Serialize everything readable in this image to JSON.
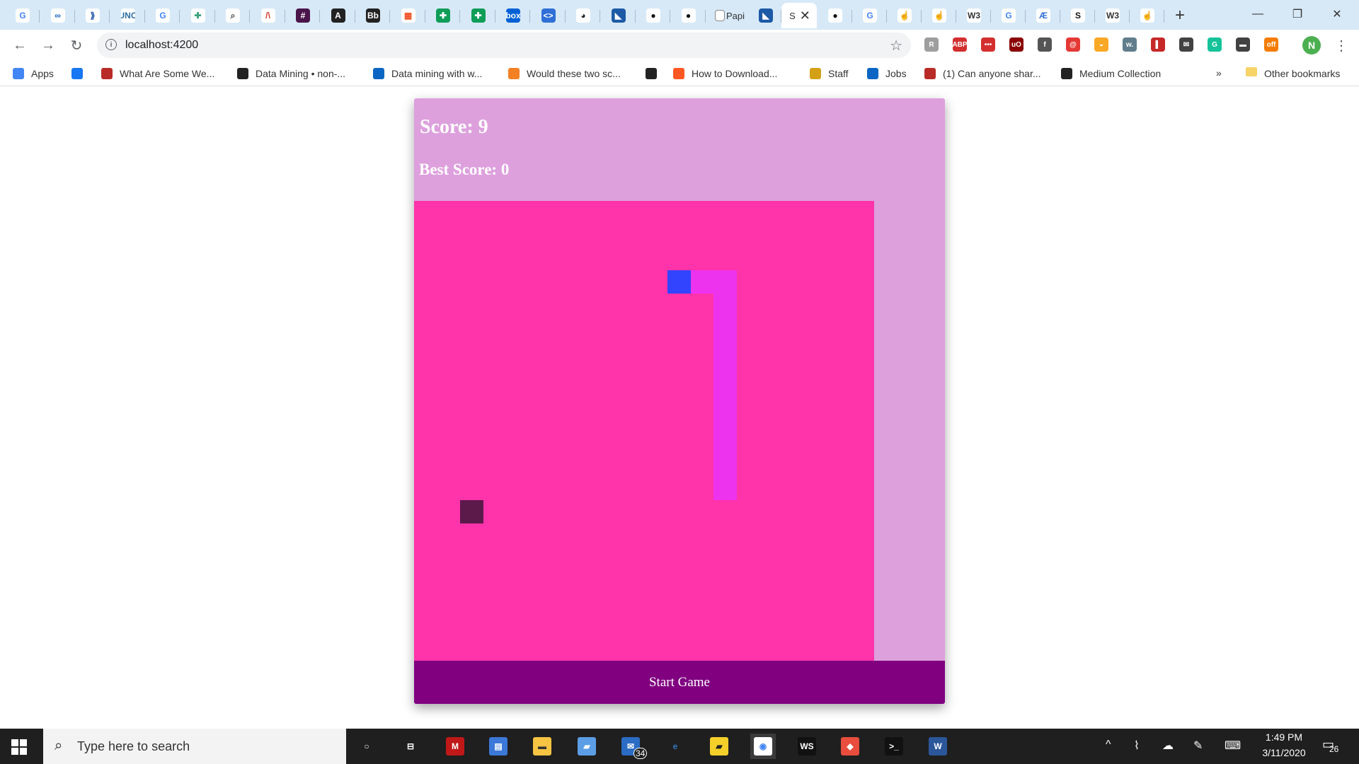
{
  "browser": {
    "tabs_pinned": [
      {
        "icon": "google-icon",
        "glyph": "G",
        "color": "#4285f4",
        "bg": "#ffffff"
      },
      {
        "icon": "coursera-icon",
        "glyph": "∞",
        "color": "#1565c0",
        "bg": "#ffffff"
      },
      {
        "icon": "forward-icon",
        "glyph": "⟫",
        "color": "#1a4ea8",
        "bg": "#ffffff"
      },
      {
        "icon": "uncc-icon",
        "glyph": "UNC",
        "color": "#2e6da4",
        "bg": "#ffffff"
      },
      {
        "icon": "google-icon",
        "glyph": "G",
        "color": "#4285f4",
        "bg": "#ffffff"
      },
      {
        "icon": "puzzle-icon",
        "glyph": "✚",
        "color": "#3aa37c",
        "bg": "#ffffff"
      },
      {
        "icon": "magnifier-icon",
        "glyph": "⌕",
        "color": "#444444",
        "bg": "#ffffff"
      },
      {
        "icon": "lambda-icon",
        "glyph": "/\\",
        "color": "#d23b2f",
        "bg": "#ffffff"
      },
      {
        "icon": "slack-icon",
        "glyph": "#",
        "color": "#ffffff",
        "bg": "#4a154b"
      },
      {
        "icon": "angular-icon",
        "glyph": "A",
        "color": "#ffffff",
        "bg": "#222222"
      },
      {
        "icon": "bb-icon",
        "glyph": "Bb",
        "color": "#ffffff",
        "bg": "#222222"
      },
      {
        "icon": "microsoft-icon",
        "glyph": "▦",
        "color": "#f25022",
        "bg": "#ffffff"
      },
      {
        "icon": "sheets-icon",
        "glyph": "✚",
        "color": "#ffffff",
        "bg": "#0f9d58"
      },
      {
        "icon": "sheets-icon",
        "glyph": "✚",
        "color": "#ffffff",
        "bg": "#0f9d58"
      },
      {
        "icon": "box-icon",
        "glyph": "box",
        "color": "#ffffff",
        "bg": "#0061d5"
      },
      {
        "icon": "code-icon",
        "glyph": "<>",
        "color": "#ffffff",
        "bg": "#2f6fd6"
      },
      {
        "icon": "globe-icon",
        "glyph": "◕",
        "color": "#222222",
        "bg": "#ffffff"
      },
      {
        "icon": "ninja-icon",
        "glyph": "◣",
        "color": "#ffffff",
        "bg": "#1c5aa6"
      },
      {
        "icon": "github-icon",
        "glyph": "●",
        "color": "#111111",
        "bg": "#ffffff"
      },
      {
        "icon": "github-icon",
        "glyph": "●",
        "color": "#111111",
        "bg": "#ffffff"
      }
    ],
    "tab_papi": {
      "icon": "page-icon",
      "title": "Papi"
    },
    "tab_ninja2": {
      "icon": "ninja-icon"
    },
    "tab_active": {
      "title": "S",
      "close": "✕"
    },
    "tabs_after": [
      {
        "icon": "github-icon",
        "glyph": "●",
        "color": "#111111",
        "bg": "#ffffff"
      },
      {
        "icon": "google-icon",
        "glyph": "G",
        "color": "#4285f4",
        "bg": "#ffffff"
      },
      {
        "icon": "hand-icon",
        "glyph": "☝",
        "color": "#e0a060",
        "bg": "#ffffff"
      },
      {
        "icon": "hand-icon",
        "glyph": "☝",
        "color": "#e0a060",
        "bg": "#ffffff"
      },
      {
        "icon": "w3-icon",
        "glyph": "W3",
        "color": "#333333",
        "bg": "#ffffff"
      },
      {
        "icon": "google-icon",
        "glyph": "G",
        "color": "#4285f4",
        "bg": "#ffffff"
      },
      {
        "icon": "azure-icon",
        "glyph": "Æ",
        "color": "#2f6fd6",
        "bg": "#ffffff"
      },
      {
        "icon": "s-icon",
        "glyph": "S",
        "color": "#111111",
        "bg": "#ffffff"
      },
      {
        "icon": "w3-icon",
        "glyph": "W3",
        "color": "#333333",
        "bg": "#ffffff"
      },
      {
        "icon": "hand-icon",
        "glyph": "☝",
        "color": "#e0a060",
        "bg": "#ffffff"
      }
    ],
    "new_tab": "+",
    "window": {
      "minimize": "—",
      "maximize": "❐",
      "close": "✕"
    },
    "nav": {
      "back": "←",
      "forward": "→",
      "reload": "↻"
    },
    "url": "localhost:4200",
    "extensions": [
      {
        "icon": "extension-icon",
        "glyph": "R",
        "bg": "#9e9e9e"
      },
      {
        "icon": "adblock-icon",
        "glyph": "ABP",
        "bg": "#d32f2f"
      },
      {
        "icon": "lastpass-icon",
        "glyph": "•••",
        "bg": "#d32f2f"
      },
      {
        "icon": "ublock-icon",
        "glyph": "uO",
        "bg": "#8b0000"
      },
      {
        "icon": "facebook-icon",
        "glyph": "f",
        "bg": "#555555"
      },
      {
        "icon": "spiral-icon",
        "glyph": "@",
        "bg": "#e53935"
      },
      {
        "icon": "honey-icon",
        "glyph": "◒",
        "bg": "#f9a825"
      },
      {
        "icon": "wordtune-icon",
        "glyph": "w.",
        "bg": "#607d8b"
      },
      {
        "icon": "book-icon",
        "glyph": "▌",
        "bg": "#c62828"
      },
      {
        "icon": "mail-icon",
        "glyph": "✉",
        "bg": "#424242"
      },
      {
        "icon": "grammarly-icon",
        "glyph": "G",
        "bg": "#15c39a"
      },
      {
        "icon": "tag-icon",
        "glyph": "▬",
        "bg": "#424242"
      },
      {
        "icon": "coupon-icon",
        "glyph": "off",
        "bg": "#f57c00"
      }
    ],
    "profile": "N",
    "bookmarks": [
      {
        "icon": "apps-icon",
        "label": "Apps",
        "color": "#4285f4"
      },
      {
        "icon": "facebook-icon",
        "label": "",
        "color": "#1877f2"
      },
      {
        "icon": "quora-icon",
        "label": "What Are Some We...",
        "color": "#b92b27"
      },
      {
        "icon": "globe-icon",
        "label": "Data Mining • non-...",
        "color": "#222222"
      },
      {
        "icon": "linkedin-icon",
        "label": "Data mining with w...",
        "color": "#0a66c2"
      },
      {
        "icon": "stack-icon",
        "label": "Would these two sc...",
        "color": "#f48024"
      },
      {
        "icon": "globe-icon",
        "label": "",
        "color": "#222222"
      },
      {
        "icon": "download-icon",
        "label": "How to Download...",
        "color": "#ff5722"
      },
      {
        "icon": "lambda-icon",
        "label": "Staff",
        "color": "#d4a017"
      },
      {
        "icon": "linkedin-icon",
        "label": "Jobs",
        "color": "#0a66c2"
      },
      {
        "icon": "quora-icon",
        "label": "(1) Can anyone shar...",
        "color": "#b92b27"
      },
      {
        "icon": "medium-icon",
        "label": "Medium Collection",
        "color": "#222222"
      }
    ],
    "bookmarks_more": "»",
    "other_bookmarks": "Other bookmarks"
  },
  "game": {
    "score_text": "Score: 9",
    "best_text": "Best Score: 0",
    "start_label": "Start Game",
    "colors": {
      "panel": "#dda0dd",
      "board": "#ff33aa",
      "snake": "#ee33ee",
      "head": "#3344ff",
      "food": "#5c1a4a",
      "button": "#800080"
    },
    "grid": {
      "cols": 20,
      "rows": 20
    },
    "snake_head": [
      11,
      3
    ],
    "snake_body": [
      [
        12,
        3
      ],
      [
        13,
        3
      ],
      [
        13,
        4
      ],
      [
        13,
        5
      ],
      [
        13,
        6
      ],
      [
        13,
        7
      ],
      [
        13,
        8
      ],
      [
        13,
        9
      ],
      [
        13,
        10
      ],
      [
        13,
        11
      ],
      [
        13,
        12
      ]
    ],
    "food": [
      2,
      13
    ]
  },
  "taskbar": {
    "search_placeholder": "Type here to search",
    "apps": [
      {
        "icon": "cortana-icon",
        "glyph": "○",
        "color": "#ffffff",
        "bg": "transparent"
      },
      {
        "icon": "task-view-icon",
        "glyph": "⊟",
        "color": "#ffffff",
        "bg": "transparent"
      },
      {
        "icon": "mcafee-icon",
        "glyph": "M",
        "color": "#ffffff",
        "bg": "#c01818"
      },
      {
        "icon": "store-icon",
        "glyph": "▤",
        "color": "#ffffff",
        "bg": "#3b78d8"
      },
      {
        "icon": "file-explorer-icon",
        "glyph": "▬",
        "color": "#333333",
        "bg": "#f6c343"
      },
      {
        "icon": "pc-icon",
        "glyph": "▰",
        "color": "#ffffff",
        "bg": "#5c9ee6"
      },
      {
        "icon": "mail-icon",
        "glyph": "✉",
        "color": "#ffffff",
        "bg": "#2b6cc4"
      },
      {
        "icon": "edge-icon",
        "glyph": "e",
        "color": "#3277bc",
        "bg": "transparent"
      },
      {
        "icon": "sticky-notes-icon",
        "glyph": "▰",
        "color": "#222222",
        "bg": "#f5d02a"
      },
      {
        "icon": "chrome-icon",
        "glyph": "◉",
        "color": "#4285f4",
        "bg": "#ffffff"
      },
      {
        "icon": "webstorm-icon",
        "glyph": "WS",
        "color": "#ffffff",
        "bg": "#111111"
      },
      {
        "icon": "git-icon",
        "glyph": "◆",
        "color": "#ffffff",
        "bg": "#e84d3d"
      },
      {
        "icon": "terminal-icon",
        "glyph": ">_",
        "color": "#ffffff",
        "bg": "#111111"
      },
      {
        "icon": "word-icon",
        "glyph": "W",
        "color": "#ffffff",
        "bg": "#2b579a"
      }
    ],
    "mail_badge": "34",
    "tray": [
      {
        "icon": "chevron-up-icon",
        "glyph": "^"
      },
      {
        "icon": "network-icon",
        "glyph": "⌇"
      },
      {
        "icon": "onedrive-icon",
        "glyph": "☁"
      },
      {
        "icon": "pen-icon",
        "glyph": "✎"
      },
      {
        "icon": "keyboard-icon",
        "glyph": "⌨"
      }
    ],
    "time": "1:49 PM",
    "date": "3/11/2020",
    "notifications": "26"
  }
}
